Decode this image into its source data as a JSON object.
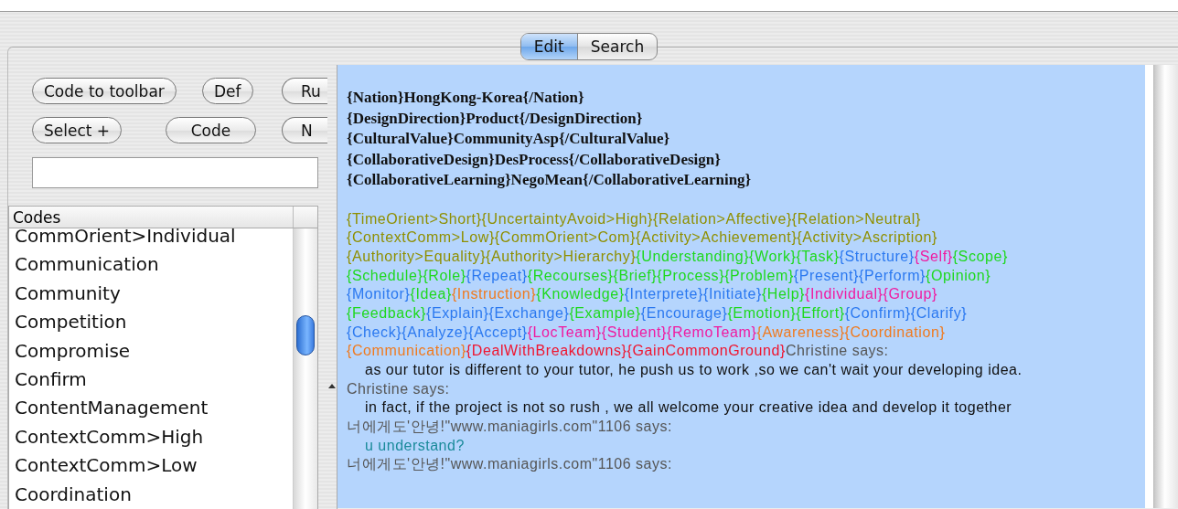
{
  "tabs": [
    {
      "label": "Edit",
      "selected": true
    },
    {
      "label": "Search",
      "selected": false
    }
  ],
  "toolbar": {
    "buttons": [
      {
        "label": "Code to toolbar",
        "cut": false
      },
      {
        "label": "Def",
        "cut": false
      },
      {
        "label": "Ru",
        "cut": true
      },
      {
        "label": "Select +",
        "cut": false
      },
      {
        "label": "Code",
        "cut": false
      },
      {
        "label": "N",
        "cut": true
      }
    ]
  },
  "codes": {
    "header": "Codes",
    "items": [
      {
        "label": "CommOrient>Individual",
        "selected": false
      },
      {
        "label": "Communication",
        "selected": false
      },
      {
        "label": "Community",
        "selected": false
      },
      {
        "label": "Competition",
        "selected": false
      },
      {
        "label": "Compromise",
        "selected": false
      },
      {
        "label": "Confirm",
        "selected": false
      },
      {
        "label": "ContentManagement",
        "selected": false
      },
      {
        "label": "ContextComm>High",
        "selected": false
      },
      {
        "label": "ContextComm>Low",
        "selected": false
      },
      {
        "label": "Coordination",
        "selected": false
      }
    ]
  },
  "text": {
    "header_lines": [
      "{Nation}HongKong-Korea{/Nation}",
      "{DesignDirection}Product{/DesignDirection}",
      "{CulturalValue}CommunityAsp{/CulturalValue}",
      "{CollaborativeDesign}DesProcess{/CollaborativeDesign}",
      "{CollaborativeLearning}NegoMean{/CollaborativeLearning}"
    ],
    "tag_lines": [
      [
        {
          "text": "{TimeOrient>Short}",
          "color": "#8f8f00"
        },
        {
          "text": "{UncertaintyAvoid>High}",
          "color": "#8f8f00"
        },
        {
          "text": "{Relation>Affective}",
          "color": "#8f8f00"
        },
        {
          "text": "{Relation>Neutral}",
          "color": "#8f8f00"
        }
      ],
      [
        {
          "text": "{ContextComm>Low}",
          "color": "#8f8f00"
        },
        {
          "text": "{CommOrient>Com}",
          "color": "#8f8f00"
        },
        {
          "text": "{Activity>Achievement}",
          "color": "#8f8f00"
        },
        {
          "text": "{Activity>Ascription}",
          "color": "#8f8f00"
        }
      ],
      [
        {
          "text": "{Authority>Equality}",
          "color": "#8f8f00"
        },
        {
          "text": "{Authority>Hierarchy}",
          "color": "#8f8f00"
        },
        {
          "text": "{Understanding}",
          "color": "#1ed81e"
        },
        {
          "text": "{Work}",
          "color": "#1ed81e"
        },
        {
          "text": "{Task}",
          "color": "#1ed81e"
        },
        {
          "text": "{Structure}",
          "color": "#2a78f0"
        },
        {
          "text": "{Self}",
          "color": "#f01aa0"
        },
        {
          "text": "{Scope}",
          "color": "#1ed81e"
        }
      ],
      [
        {
          "text": "{Schedule}",
          "color": "#1ed81e"
        },
        {
          "text": "{Role}",
          "color": "#1ed81e"
        },
        {
          "text": "{Repeat}",
          "color": "#2a78f0"
        },
        {
          "text": "{Recourses}",
          "color": "#1ed81e"
        },
        {
          "text": "{Brief}",
          "color": "#1ed81e"
        },
        {
          "text": "{Process}",
          "color": "#1ed81e"
        },
        {
          "text": "{Problem}",
          "color": "#1ed81e"
        },
        {
          "text": "{Present}",
          "color": "#2a78f0"
        },
        {
          "text": "{Perform}",
          "color": "#2a78f0"
        },
        {
          "text": "{Opinion}",
          "color": "#1ed81e"
        }
      ],
      [
        {
          "text": "{Monitor}",
          "color": "#2a78f0"
        },
        {
          "text": "{Idea}",
          "color": "#1ed81e"
        },
        {
          "text": "{Instruction}",
          "color": "#f07a1e"
        },
        {
          "text": "{Knowledge}",
          "color": "#1ed81e"
        },
        {
          "text": "{Interprete}",
          "color": "#2a78f0"
        },
        {
          "text": "{Initiate}",
          "color": "#2a78f0"
        },
        {
          "text": "{Help}",
          "color": "#1ed81e"
        },
        {
          "text": "{Individual}",
          "color": "#f01aa0"
        },
        {
          "text": "{Group}",
          "color": "#f01aa0"
        }
      ],
      [
        {
          "text": "{Feedback}",
          "color": "#1ed81e"
        },
        {
          "text": "{Explain}",
          "color": "#2a78f0"
        },
        {
          "text": "{Exchange}",
          "color": "#2a78f0"
        },
        {
          "text": "{Example}",
          "color": "#1ed81e"
        },
        {
          "text": "{Encourage}",
          "color": "#2a78f0"
        },
        {
          "text": "{Emotion}",
          "color": "#1ed81e"
        },
        {
          "text": "{Effort}",
          "color": "#1ed81e"
        },
        {
          "text": "{Confirm}",
          "color": "#2a78f0"
        },
        {
          "text": "{Clarify}",
          "color": "#2a78f0"
        }
      ],
      [
        {
          "text": "{Check}",
          "color": "#2a78f0"
        },
        {
          "text": "{Analyze}",
          "color": "#2a78f0"
        },
        {
          "text": "{Accept}",
          "color": "#2a78f0"
        },
        {
          "text": "{LocTeam}",
          "color": "#f01aa0"
        },
        {
          "text": "{Student}",
          "color": "#f01aa0"
        },
        {
          "text": "{RemoTeam}",
          "color": "#f01aa0"
        },
        {
          "text": "{Awareness}",
          "color": "#f07a1e"
        },
        {
          "text": "{Coordination}",
          "color": "#f07a1e"
        }
      ],
      [
        {
          "text": "{Communication}",
          "color": "#f07a1e"
        },
        {
          "text": "{DealWithBreakdowns}",
          "color": "#f0142e"
        },
        {
          "text": "{GainCommonGround}",
          "color": "#f0142e"
        }
      ]
    ],
    "chat": [
      {
        "kind": "speaker",
        "text": "Christine  says:",
        "color": "#555555"
      },
      {
        "kind": "message",
        "text": "as our tutor is different to your tutor, he push us to work ,so we can't wait your developing idea.",
        "color": "#111111"
      },
      {
        "kind": "speaker",
        "text": "Christine  says:",
        "color": "#555555"
      },
      {
        "kind": "message",
        "text": "in fact, if the project is not so rush , we all welcome your creative idea and develop it together",
        "color": "#111111"
      },
      {
        "kind": "speaker",
        "text": "너에게도'안녕!\"www.maniagirls.com\"1106 says:",
        "color": "#555555"
      },
      {
        "kind": "message",
        "text": "u understand?",
        "color": "#1a8a9a"
      },
      {
        "kind": "speaker",
        "text": "너에게도'안녕!\"www.maniagirls.com\"1106 says:",
        "color": "#555555"
      }
    ]
  }
}
